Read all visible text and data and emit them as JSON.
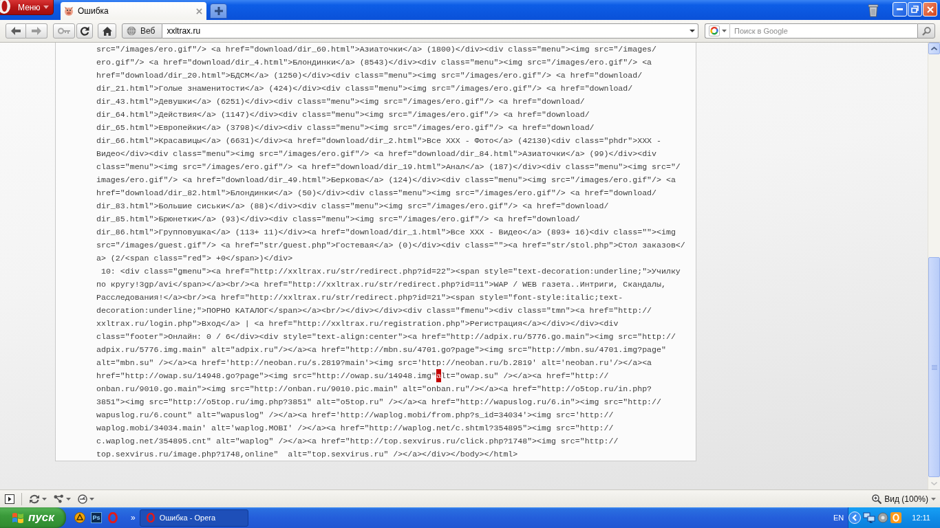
{
  "browser": {
    "menu_button": "Меню",
    "tabs": [
      {
        "title": "Ошибка",
        "selected": true
      }
    ],
    "address_bar": {
      "scope_label": "Веб",
      "value": "xxltrax.ru"
    },
    "search_bar": {
      "placeholder": "Поиск в Google"
    }
  },
  "source_view": {
    "lines": [
      {
        "kind": "plain",
        "text": "src=\"/images/ero.gif\"/> <a href=\"download/dir_60.html\">Азиаточки</a> (1800)</div><div class=\"menu\"><img src=\"/images/"
      },
      {
        "kind": "plain",
        "text": "ero.gif\"/> <a href=\"download/dir_4.html\">Блондинки</a> (8543)</div><div class=\"menu\"><img src=\"/images/ero.gif\"/> <a"
      },
      {
        "kind": "plain",
        "text": "href=\"download/dir_20.html\">БДСМ</a> (1250)</div><div class=\"menu\"><img src=\"/images/ero.gif\"/> <a href=\"download/"
      },
      {
        "kind": "plain",
        "text": "dir_21.html\">Голые знаменитости</a> (424)</div><div class=\"menu\"><img src=\"/images/ero.gif\"/> <a href=\"download/"
      },
      {
        "kind": "plain",
        "text": "dir_43.html\">Девушки</a> (6251)</div><div class=\"menu\"><img src=\"/images/ero.gif\"/> <a href=\"download/"
      },
      {
        "kind": "plain",
        "text": "dir_64.html\">Действия</a> (1147)</div><div class=\"menu\"><img src=\"/images/ero.gif\"/> <a href=\"download/"
      },
      {
        "kind": "plain",
        "text": "dir_65.html\">Европейки</a> (3798)</div><div class=\"menu\"><img src=\"/images/ero.gif\"/> <a href=\"download/"
      },
      {
        "kind": "plain",
        "text": "dir_66.html\">Красавицы</a> (6631)</div><a href=\"download/dir_2.html\">Все XXX - Фото</a> (42130)<div class=\"phdr\">XXX -"
      },
      {
        "kind": "plain",
        "text": "Видео</div><div class=\"menu\"><img src=\"/images/ero.gif\"/> <a href=\"download/dir_84.html\">Азиаточки</a> (99)</div><div"
      },
      {
        "kind": "plain",
        "text": "class=\"menu\"><img src=\"/images/ero.gif\"/> <a href=\"download/dir_19.html\">Анал</a> (187)</div><div class=\"menu\"><img src=\"/"
      },
      {
        "kind": "plain",
        "text": "images/ero.gif\"/> <a href=\"download/dir_49.html\">Беркова</a> (124)</div><div class=\"menu\"><img src=\"/images/ero.gif\"/> <a"
      },
      {
        "kind": "plain",
        "text": "href=\"download/dir_82.html\">Блондинки</a> (50)</div><div class=\"menu\"><img src=\"/images/ero.gif\"/> <a href=\"download/"
      },
      {
        "kind": "plain",
        "text": "dir_83.html\">Большие сиськи</a> (88)</div><div class=\"menu\"><img src=\"/images/ero.gif\"/> <a href=\"download/"
      },
      {
        "kind": "plain",
        "text": "dir_85.html\">Брюнетки</a> (93)</div><div class=\"menu\"><img src=\"/images/ero.gif\"/> <a href=\"download/"
      },
      {
        "kind": "plain",
        "text": "dir_86.html\">Групповушка</a> (113+ 11)</div><a href=\"download/dir_1.html\">Все XXX - Видео</a> (893+ 16)<div class=\"\"><img"
      },
      {
        "kind": "plain",
        "text": "src=\"/images/guest.gif\"/> <a href=\"str/guest.php\">Гостевая</a> (0)</div><div class=\"\"><a href=\"str/stol.php\">Стол заказов</"
      },
      {
        "kind": "plain",
        "text": "a> (2/<span class=\"red\"> +0</span>)</div>"
      },
      {
        "kind": "plain",
        "text": " 10: <div class=\"gmenu\"><a href=\"http://xxltrax.ru/str/redirect.php?id=22\"><span style=\"text-decoration:underline;\">Училку"
      },
      {
        "kind": "plain",
        "text": "по кругу!3gp/avi</span></a><br/><a href=\"http://xxltrax.ru/str/redirect.php?id=11\">WAP / WEB газета..Интриги, Скандалы,"
      },
      {
        "kind": "plain",
        "text": "Расследования!</a><br/><a href=\"http://xxltrax.ru/str/redirect.php?id=21\"><span style=\"font-style:italic;text-"
      },
      {
        "kind": "plain",
        "text": "decoration:underline;\">ПОРНО КАТАЛОГ</span></a><br/></div></div><div class=\"fmenu\"><div class=\"tmn\"><a href=\"http://"
      },
      {
        "kind": "plain",
        "text": "xxltrax.ru/login.php\">Вход</a> | <a href=\"http://xxltrax.ru/registration.php\">Регистрация</a></div></div><div"
      },
      {
        "kind": "plain",
        "text": "class=\"footer\">Онлайн: 0 / 6</div><div style=\"text-align:center\"><a href=\"http://adpix.ru/5776.go.main\"><img src=\"http://"
      },
      {
        "kind": "plain",
        "text": "adpix.ru/5776.img.main\" alt=\"adpix.ru\"/></a><a href=\"http://mbn.su/4701.go?page\"><img src=\"http://mbn.su/4701.img?page\""
      },
      {
        "kind": "plain",
        "text": "alt=\"mbn.su\" /></a><a href='http://neoban.ru/s.2819?main'><img src='http://neoban.ru/b.2819' alt='neoban.ru'/></a><a"
      },
      {
        "kind": "marked",
        "before": "href=\"http://owap.su/14948.go?page\"><img src=\"http://owap.su/14948.img\"",
        "mark": "a",
        "after": "lt=\"owap.su\" /></a><a href=\"http://"
      },
      {
        "kind": "plain",
        "text": "onban.ru/9010.go.main\"><img src=\"http://onban.ru/9010.pic.main\" alt=\"onban.ru\"/></a><a href=\"http://o5top.ru/in.php?"
      },
      {
        "kind": "plain",
        "text": "3851\"><img src=\"http://o5top.ru/img.php?3851\" alt=\"o5top.ru\" /></a><a href=\"http://wapuslog.ru/6.in\"><img src=\"http://"
      },
      {
        "kind": "plain",
        "text": "wapuslog.ru/6.count\" alt=\"wapuslog\" /></a><a href='http://waplog.mobi/from.php?s_id=34034'><img src='http://"
      },
      {
        "kind": "plain",
        "text": "waplog.mobi/34034.main' alt='waplog.MOBI' /></a><a href=\"http://waplog.net/c.shtml?354895\"><img src=\"http://"
      },
      {
        "kind": "plain",
        "text": "c.waplog.net/354895.cnt\" alt=\"waplog\" /></a><a href=\"http://top.sexvirus.ru/click.php?1748\"><img src=\"http://"
      },
      {
        "kind": "plain",
        "text": "top.sexvirus.ru/image.php?1748,online\"  alt=\"top.sexvirus.ru\" /></a></div></body></html>"
      }
    ]
  },
  "status_bar": {
    "zoom_label": "Вид (100%)"
  },
  "taskbar": {
    "start_label": "пуск",
    "quick_launch": [
      {
        "kind": "round"
      },
      {
        "kind": "lettered",
        "label": "Ps"
      },
      {
        "kind": "logo"
      }
    ],
    "overflow": "»",
    "tasks": [
      {
        "title": "Ошибка - Opera",
        "selected": true
      }
    ],
    "language": "EN",
    "clock": "12:11"
  }
}
